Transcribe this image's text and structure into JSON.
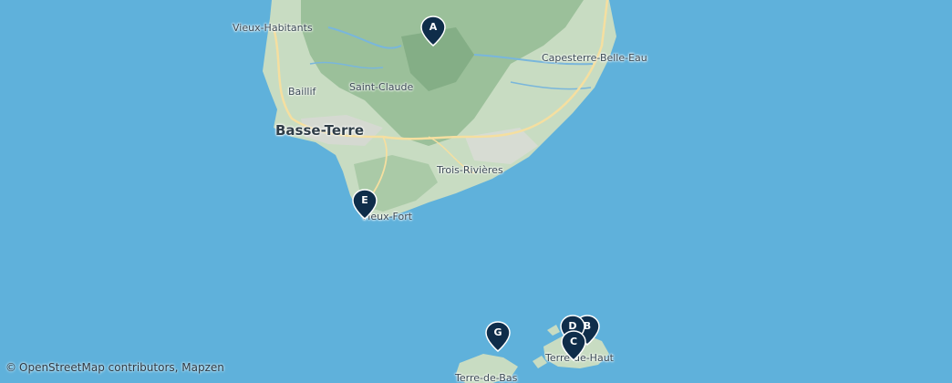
{
  "map": {
    "water_color": "#5fb1db",
    "land_color": "#c7dcc3",
    "relief_color": "#8fb892",
    "road_color": "#f4e0a6",
    "marker_color": "#0f2d4a"
  },
  "places": {
    "vieux_habitants": "Vieux-Habitants",
    "capesterre": "Capesterre-Belle-Eau",
    "saint_claude": "Saint-Claude",
    "baillif": "Baillif",
    "basse_terre": "Basse-Terre",
    "trois_rivieres": "Trois-Rivières",
    "vieux_fort": "Vieux-Fort",
    "terre_de_haut": "Terre-de-Haut",
    "terre_de_bas": "Terre-de-Bas"
  },
  "markers": {
    "a": "A",
    "b": "B",
    "c": "C",
    "d": "D",
    "e": "E",
    "g": "G"
  },
  "attribution": {
    "symbol": "©",
    "text": "OpenStreetMap contributors, Mapzen"
  }
}
